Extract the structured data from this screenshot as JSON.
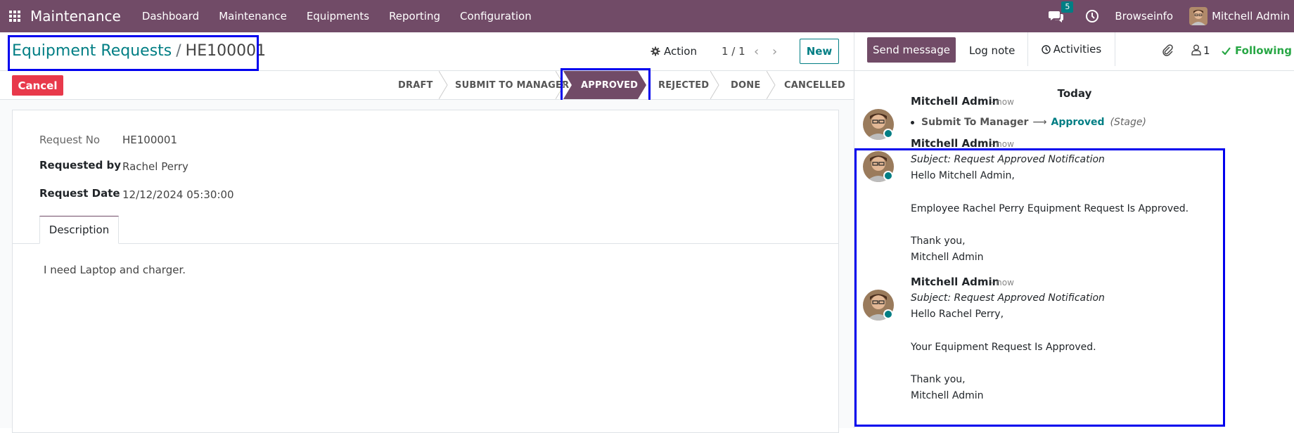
{
  "navbar": {
    "brand": "Maintenance",
    "menu": [
      "Dashboard",
      "Maintenance",
      "Equipments",
      "Reporting",
      "Configuration"
    ],
    "chat_badge": "5",
    "company": "Browseinfo",
    "user": "Mitchell Admin"
  },
  "control": {
    "breadcrumb_parent": "Equipment Requests",
    "breadcrumb_sep": "/",
    "breadcrumb_current": "HE100001",
    "action_label": "Action",
    "pager": "1 / 1",
    "new_label": "New"
  },
  "statusbar": {
    "cancel_label": "Cancel",
    "stages": [
      "DRAFT",
      "SUBMIT TO MANAGER",
      "APPROVED",
      "REJECTED",
      "DONE",
      "CANCELLED"
    ],
    "active_stage": "APPROVED"
  },
  "form": {
    "request_no_label": "Request No",
    "request_no": "HE100001",
    "requested_by_label": "Requested by",
    "requested_by": "Rachel Perry",
    "request_date_label": "Request Date",
    "request_date": "12/12/2024 05:30:00",
    "tab_description": "Description",
    "description": "I need Laptop and charger."
  },
  "chatter": {
    "send_message": "Send message",
    "log_note": "Log note",
    "activities": "Activities",
    "followers_count": "1",
    "following": "Following",
    "today": "Today",
    "messages": [
      {
        "author": "Mitchell Admin",
        "time": "- now",
        "old_stage": "Submit To Manager",
        "new_stage": "Approved",
        "field": "(Stage)"
      },
      {
        "author": "Mitchell Admin",
        "time": "- now",
        "subject": "Subject: Request Approved Notification",
        "lines": [
          "Hello Mitchell Admin,",
          "Employee Rachel Perry Equipment Request Is Approved.",
          "Thank you,",
          "Mitchell Admin"
        ]
      },
      {
        "author": "Mitchell Admin",
        "time": "- now",
        "subject": "Subject: Request Approved Notification",
        "lines": [
          "Hello Rachel Perry,",
          "Your Equipment Request Is Approved.",
          "Thank you,",
          "Mitchell Admin"
        ]
      }
    ]
  },
  "colors": {
    "brand": "#714b67",
    "accent": "#017e84",
    "danger": "#e8394b",
    "highlight": "#0000ee",
    "following": "#28a745"
  }
}
